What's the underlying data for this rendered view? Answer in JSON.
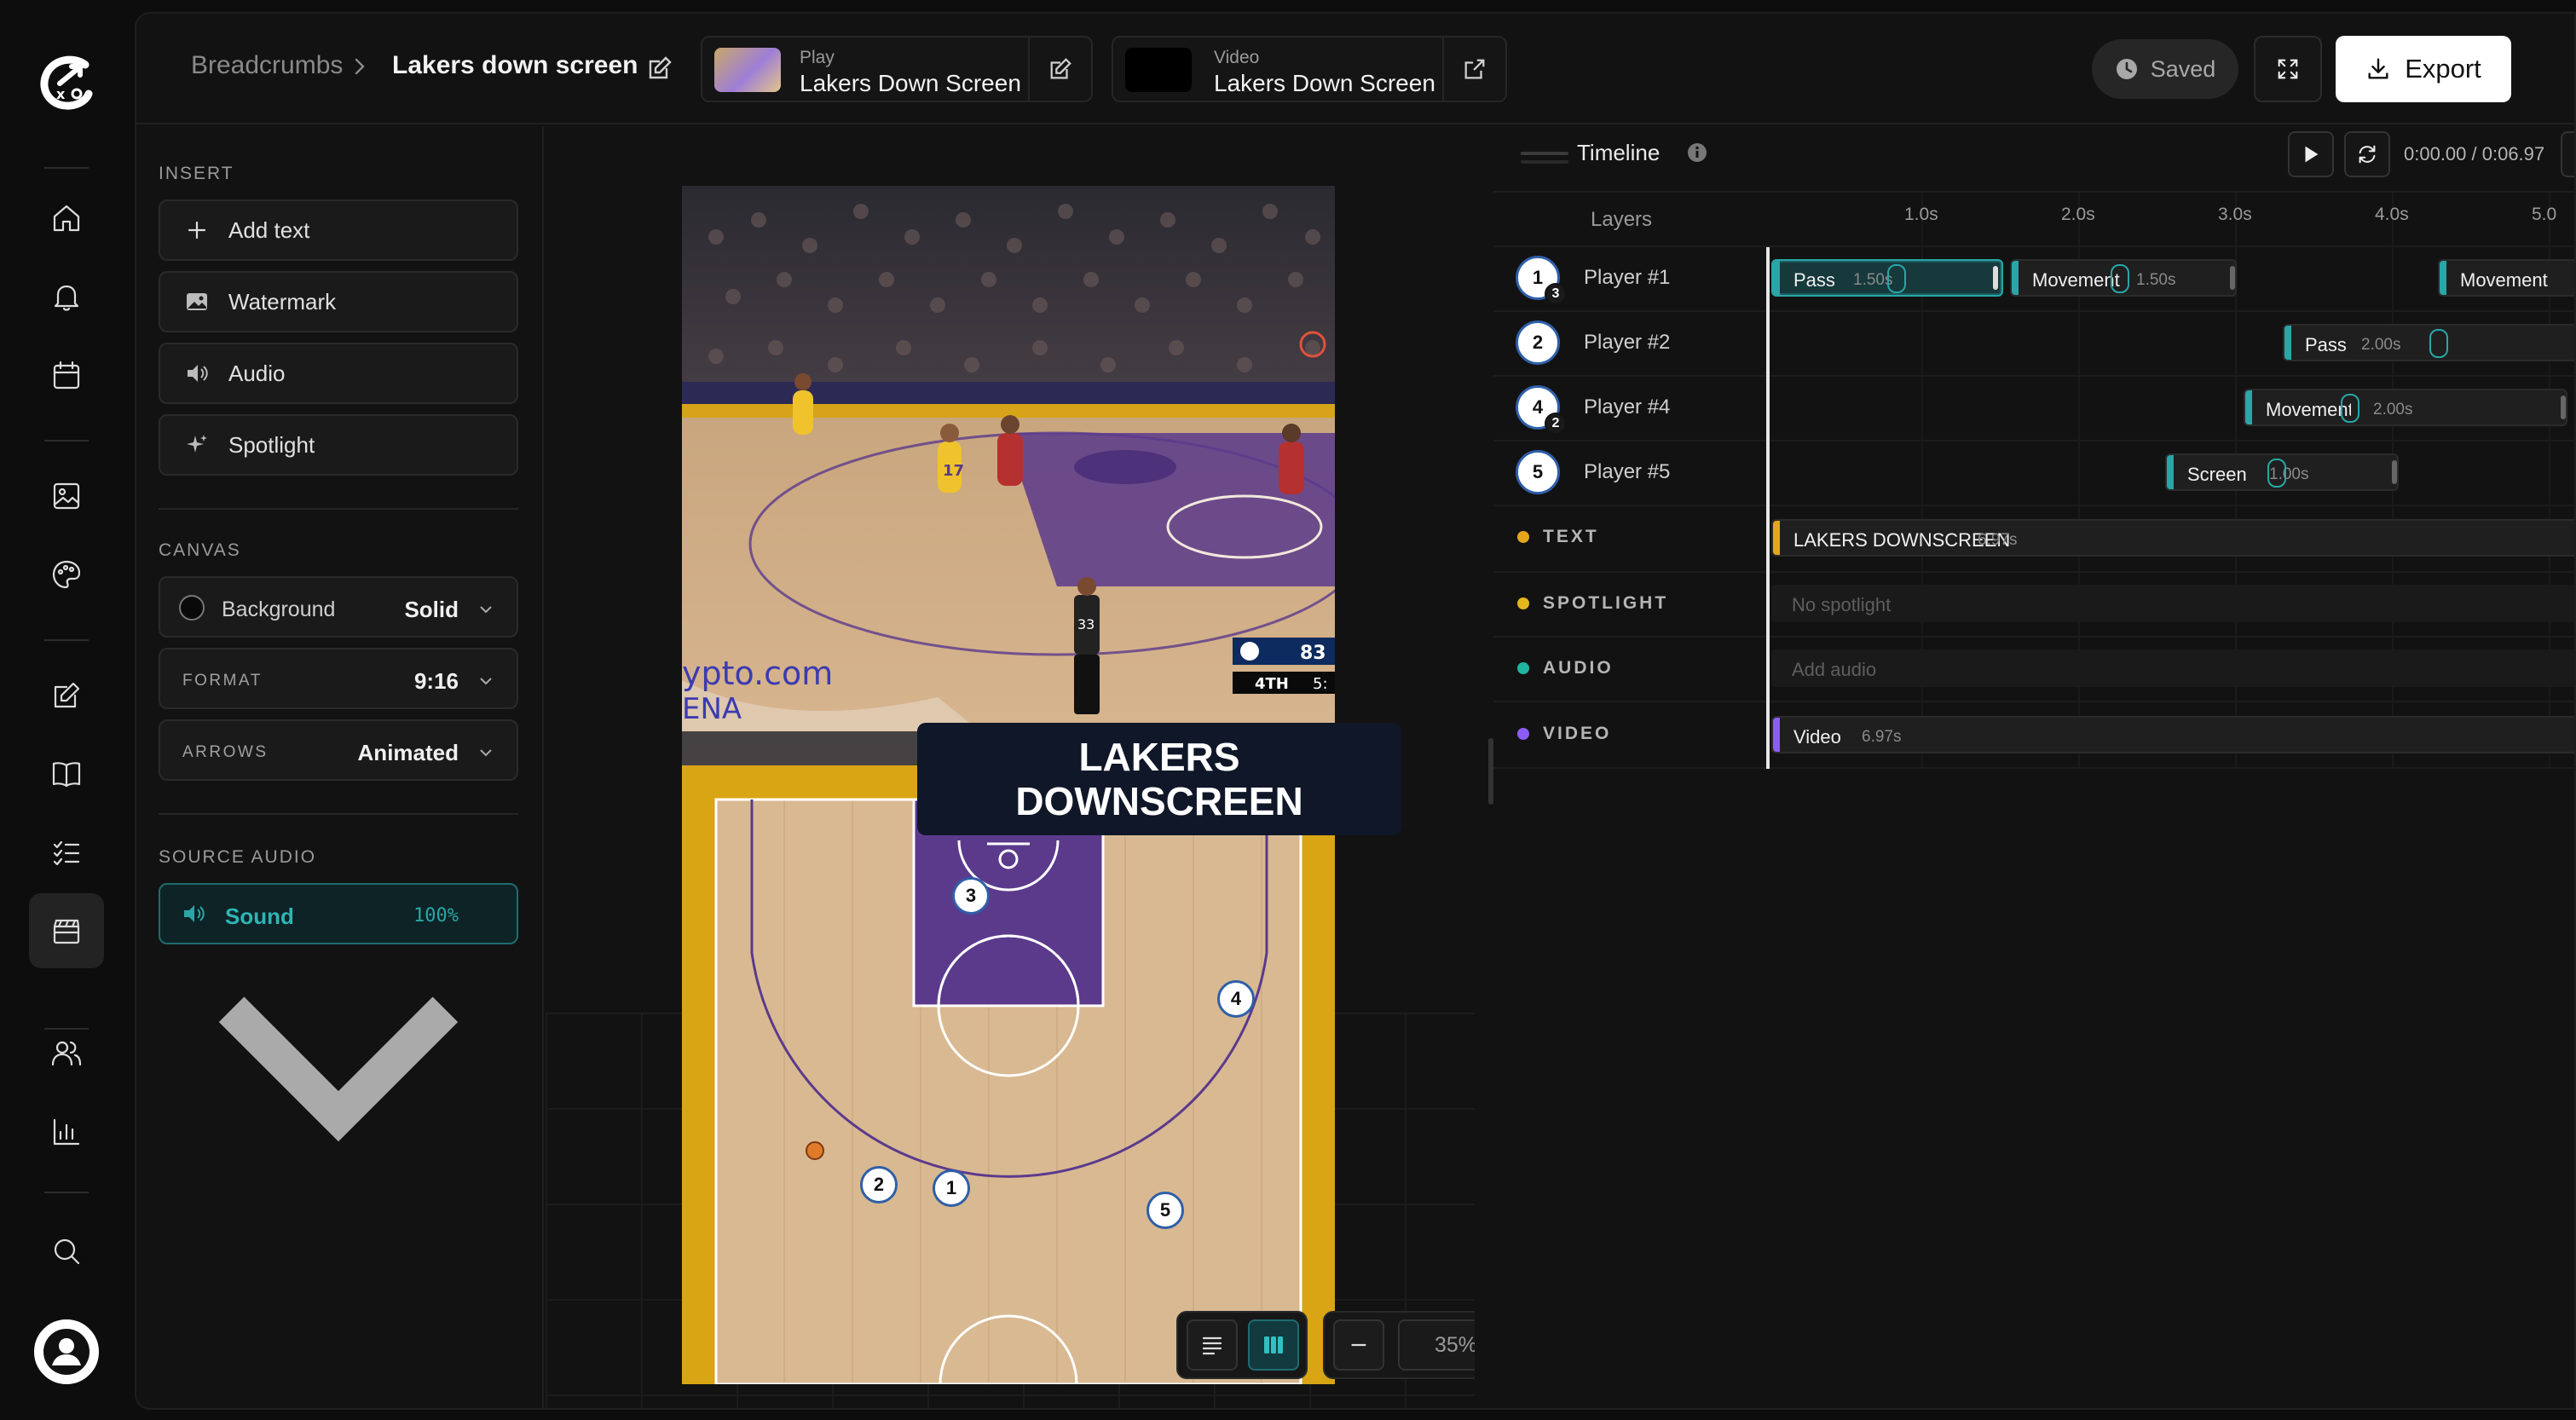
{
  "header": {
    "breadcrumb_root": "Breadcrumbs",
    "breadcrumb_current": "Lakers down screen",
    "play_label": "Play",
    "play_name": "Lakers Down Screen",
    "video_label": "Video",
    "video_name": "Lakers Down Screen",
    "saved_label": "Saved",
    "export_label": "Export"
  },
  "panel": {
    "insert_title": "INSERT",
    "insert_items": [
      {
        "label": "Add text",
        "icon": "plus-icon"
      },
      {
        "label": "Watermark",
        "icon": "image-icon"
      },
      {
        "label": "Audio",
        "icon": "speaker-icon"
      },
      {
        "label": "Spotlight",
        "icon": "sparkle-icon"
      }
    ],
    "canvas_title": "CANVAS",
    "background_label": "Background",
    "background_value": "Solid",
    "format_label": "FORMAT",
    "format_value": "9:16",
    "arrows_label": "ARROWS",
    "arrows_value": "Animated",
    "source_audio_title": "SOURCE AUDIO",
    "sound_label": "Sound",
    "sound_value": "100%"
  },
  "canvas": {
    "overlay_line1": "LAKERS",
    "overlay_line2": "DOWNSCREEN",
    "zoom": "35%",
    "scoreboard": {
      "score": "83",
      "quarter": "4TH",
      "clock": "5:"
    },
    "ad_text": "ypto.com",
    "ad_text2": "ENA",
    "jersey_17": "17",
    "ref_number": "33",
    "players": [
      {
        "num": "1"
      },
      {
        "num": "2"
      },
      {
        "num": "3"
      },
      {
        "num": "4"
      },
      {
        "num": "5"
      }
    ]
  },
  "timeline": {
    "title": "Timeline",
    "time": "0:00.00 / 0:06.97",
    "layers_label": "Layers",
    "ruler": [
      "1.0s",
      "2.0s",
      "3.0s",
      "4.0s",
      "5.0"
    ],
    "players": [
      {
        "num": "1",
        "badge": "3",
        "name": "Player #1"
      },
      {
        "num": "2",
        "badge": "",
        "name": "Player #2"
      },
      {
        "num": "4",
        "badge": "2",
        "name": "Player #4"
      },
      {
        "num": "5",
        "badge": "",
        "name": "Player #5"
      }
    ],
    "clips": {
      "p1_pass": {
        "label": "Pass",
        "dur": "1.50s"
      },
      "p1_move": {
        "label": "Movement",
        "dur": "1.50s"
      },
      "p1_move2": {
        "label": "Movement"
      },
      "p2_pass": {
        "label": "Pass",
        "dur": "2.00s"
      },
      "p4_move": {
        "label": "Movement",
        "dur": "2.00s"
      },
      "p5_screen": {
        "label": "Screen",
        "dur": "1.00s"
      },
      "text_clip": {
        "label": "LAKERS DOWNSCREEN",
        "dur": "6.97s"
      },
      "video_clip": {
        "label": "Video",
        "dur": "6.97s"
      }
    },
    "categories": {
      "text": "TEXT",
      "spotlight": "SPOTLIGHT",
      "audio": "AUDIO",
      "video": "VIDEO"
    },
    "no_spotlight": "No spotlight",
    "add_audio": "Add audio"
  },
  "colors": {
    "accent": "#2aa6a6",
    "text_dot": "#e5a61c",
    "spotlight_dot": "#e5b71c",
    "audio_dot": "#1fb5a0",
    "video_dot": "#8b5cf6",
    "court_purple": "#5b3a8c",
    "court_gold": "#d9a514"
  }
}
